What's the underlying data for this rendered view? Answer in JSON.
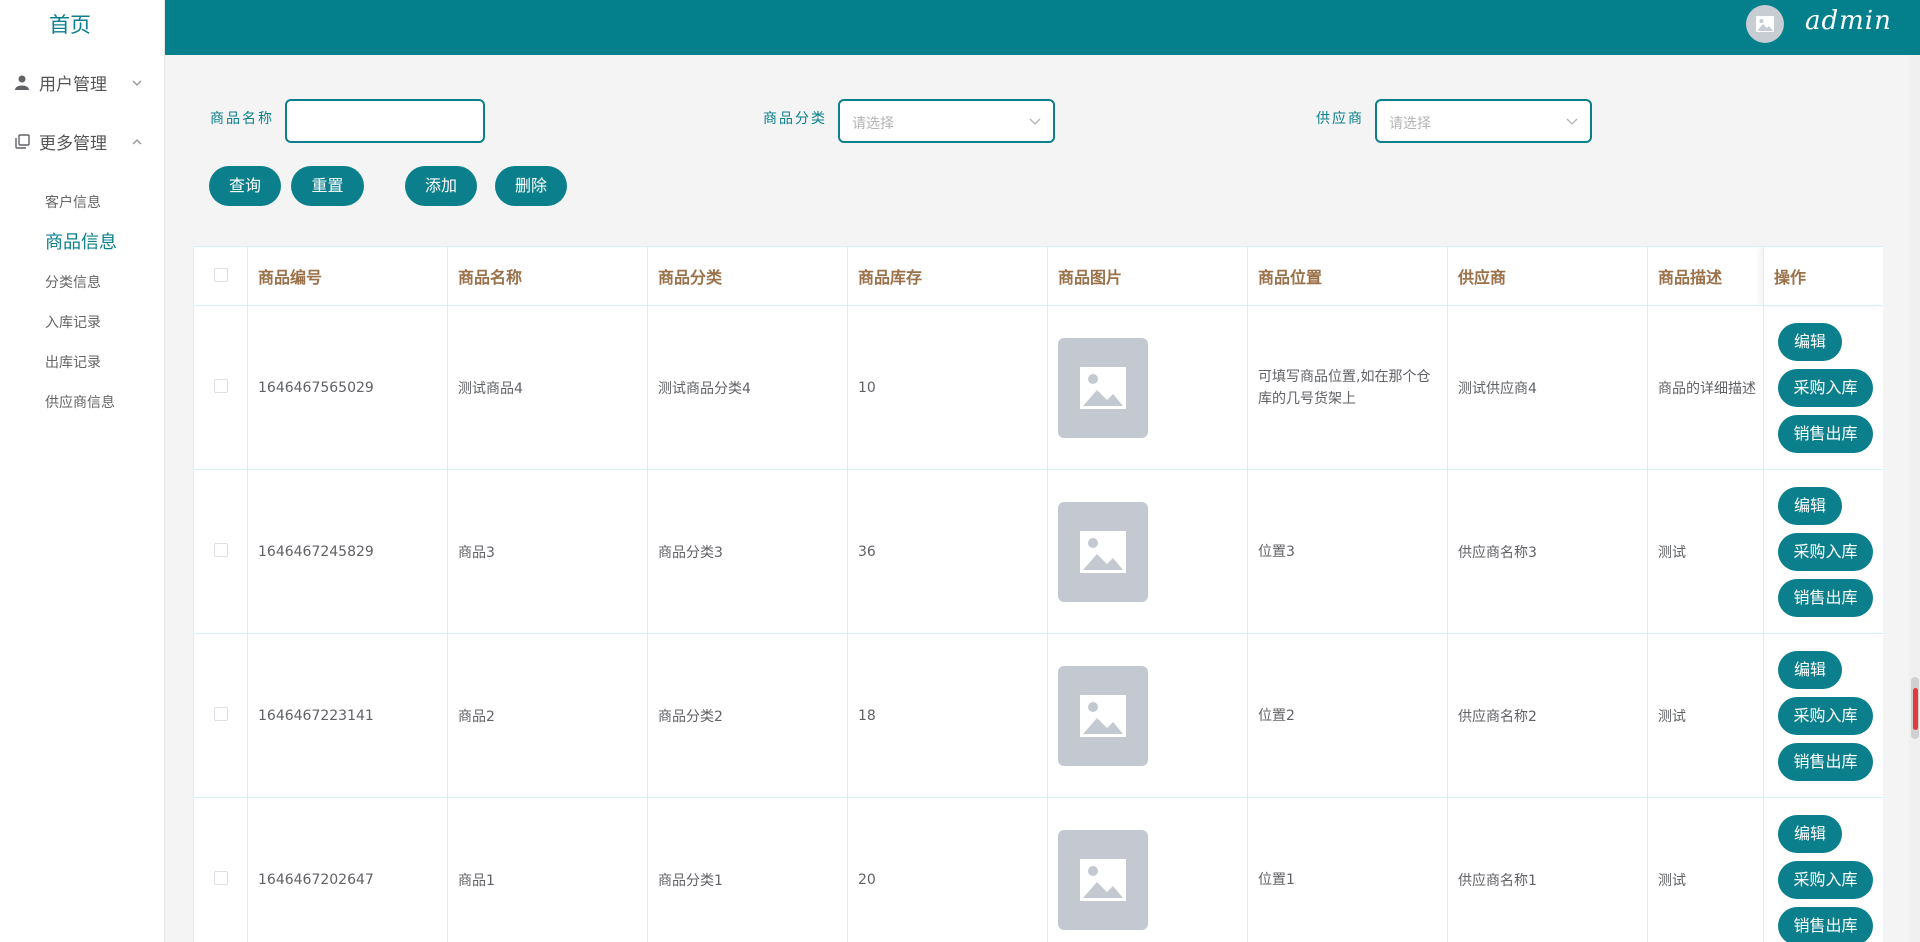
{
  "sidebar": {
    "home": "首页",
    "menus": [
      {
        "label": "用户管理",
        "icon": "user-icon",
        "expanded": false
      },
      {
        "label": "更多管理",
        "icon": "copy-icon",
        "expanded": true
      }
    ],
    "subitems": [
      {
        "label": "客户信息",
        "active": false
      },
      {
        "label": "商品信息",
        "active": true
      },
      {
        "label": "分类信息",
        "active": false
      },
      {
        "label": "入库记录",
        "active": false
      },
      {
        "label": "出库记录",
        "active": false
      },
      {
        "label": "供应商信息",
        "active": false
      }
    ]
  },
  "header": {
    "username": "admin",
    "avatar_icon": "image-icon"
  },
  "filters": {
    "name_label": "商品名称",
    "name_value": "",
    "category_label": "商品分类",
    "category_placeholder": "请选择",
    "supplier_label": "供应商",
    "supplier_placeholder": "请选择"
  },
  "buttons": {
    "query": "查询",
    "reset": "重置",
    "add": "添加",
    "delete": "删除"
  },
  "table": {
    "columns": [
      "商品编号",
      "商品名称",
      "商品分类",
      "商品库存",
      "商品图片",
      "商品位置",
      "供应商",
      "商品描述",
      "操作"
    ],
    "rows": [
      {
        "id": "1646467565029",
        "name": "测试商品4",
        "category": "测试商品分类4",
        "stock": "10",
        "position": "可填写商品位置,如在那个仓库的几号货架上",
        "supplier": "测试供应商4",
        "desc": "商品的详细描述"
      },
      {
        "id": "1646467245829",
        "name": "商品3",
        "category": "商品分类3",
        "stock": "36",
        "position": "位置3",
        "supplier": "供应商名称3",
        "desc": "测试"
      },
      {
        "id": "1646467223141",
        "name": "商品2",
        "category": "商品分类2",
        "stock": "18",
        "position": "位置2",
        "supplier": "供应商名称2",
        "desc": "测试"
      },
      {
        "id": "1646467202647",
        "name": "商品1",
        "category": "商品分类1",
        "stock": "20",
        "position": "位置1",
        "supplier": "供应商名称1",
        "desc": "测试"
      }
    ],
    "actions": {
      "edit": "编辑",
      "purchase_in": "采购入库",
      "sale_out": "销售出库"
    }
  },
  "colors": {
    "primary": "#0b808c",
    "header": "#04808c",
    "th_text": "#9a7149"
  }
}
